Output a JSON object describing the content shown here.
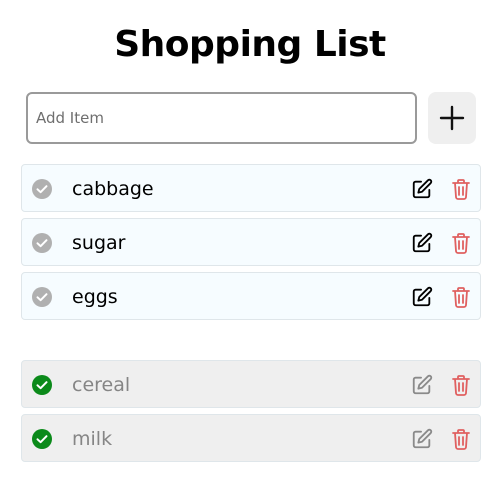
{
  "title": "Shopping List",
  "add_item": {
    "placeholder": "Add Item",
    "value": "",
    "button_icon": "plus-icon"
  },
  "pending_items": [
    {
      "label": "cabbage",
      "checked": false
    },
    {
      "label": "sugar",
      "checked": false
    },
    {
      "label": "eggs",
      "checked": false
    }
  ],
  "completed_items": [
    {
      "label": "cereal",
      "checked": true
    },
    {
      "label": "milk",
      "checked": true
    }
  ],
  "icons": {
    "check_unchecked": "circle-check-icon",
    "check_checked": "circle-check-filled-icon",
    "edit": "edit-pencil-icon",
    "delete": "trash-icon"
  },
  "colors": {
    "checked_green": "#0b8a1a",
    "unchecked_grey": "#b0b0b0",
    "delete_red": "#e06060",
    "pending_bg": "#f6fcff",
    "done_bg": "#efefef"
  }
}
